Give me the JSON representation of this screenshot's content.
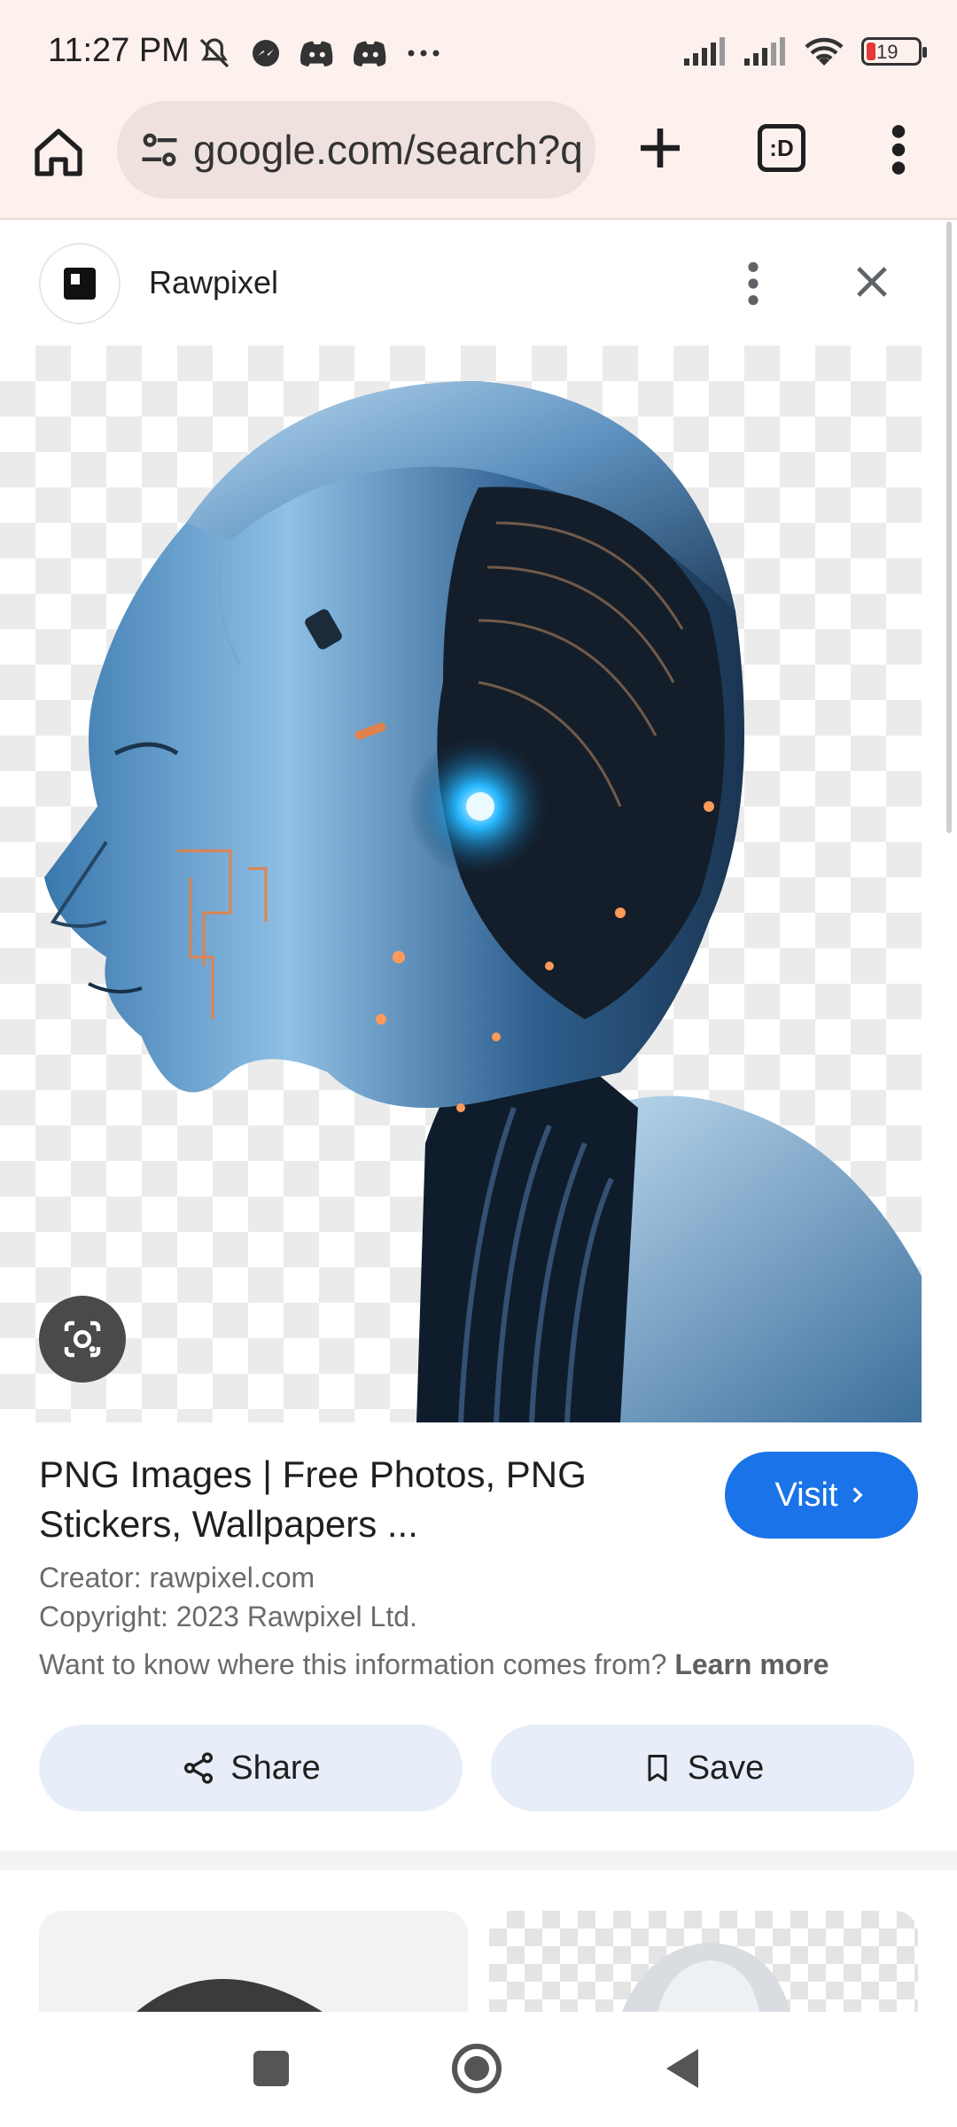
{
  "status_bar": {
    "time": "11:27 PM",
    "battery": "19",
    "left_icons": [
      "mute-icon",
      "messenger-icon",
      "discord-icon",
      "discord-icon",
      "more-dots-icon"
    ],
    "right_icons": [
      "signal-icon",
      "signal-icon",
      "wifi-icon",
      "battery-icon"
    ]
  },
  "browser": {
    "url": "google.com/search?q",
    "tabs_label": ":D"
  },
  "source": {
    "name": "Rawpixel"
  },
  "result": {
    "title": "PNG Images | Free Photos, PNG Stickers, Wallpapers ...",
    "visit_label": "Visit",
    "creator": "Creator: rawpixel.com",
    "copyright": "Copyright: 2023 Rawpixel Ltd.",
    "info_question": "Want to know where this information comes from?",
    "learn_more": "Learn more"
  },
  "actions": {
    "share_label": "Share",
    "save_label": "Save"
  },
  "colors": {
    "accent": "#1a73e8",
    "action_bg": "#e8eef9",
    "topbar_bg": "#fdf1ee"
  }
}
